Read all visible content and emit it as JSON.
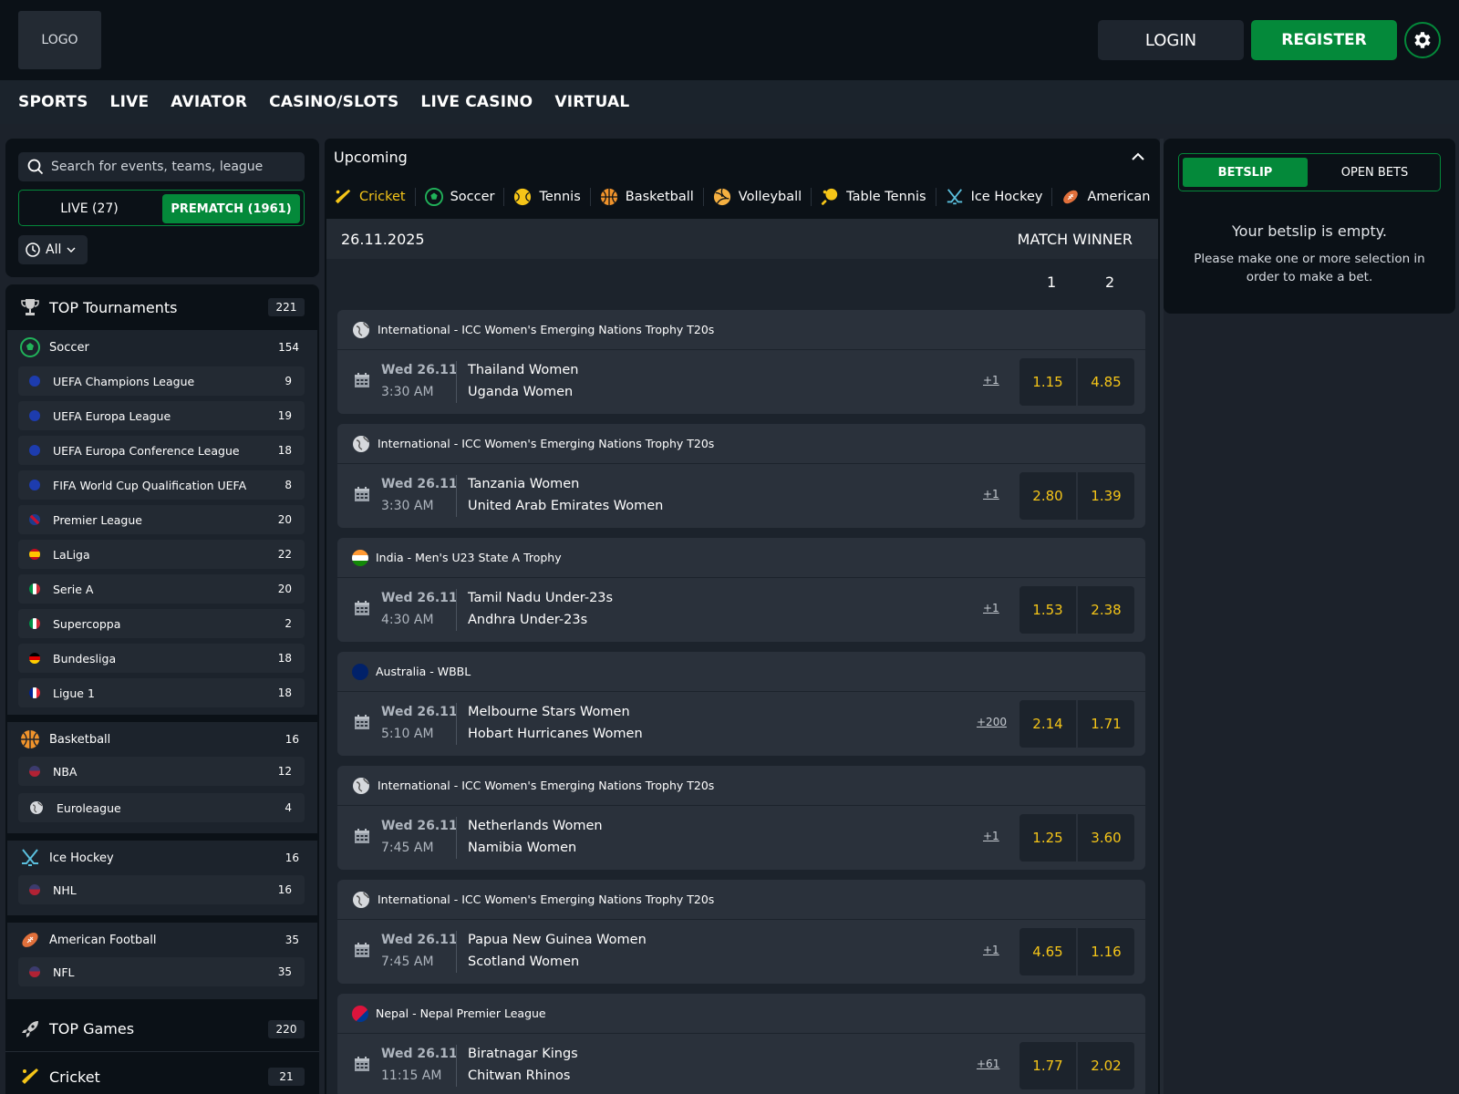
{
  "header": {
    "logo": "LOGO",
    "login": "LOGIN",
    "register": "REGISTER",
    "settings_icon": "gear-icon"
  },
  "nav": [
    "SPORTS",
    "LIVE",
    "AVIATOR",
    "CASINO/SLOTS",
    "LIVE CASINO",
    "VIRTUAL"
  ],
  "filters": {
    "search_placeholder": "Search for events, teams, league",
    "live_label": "LIVE (27)",
    "prematch_label": "PREMATCH (1961)",
    "time_filter": "All"
  },
  "sidebar": {
    "top_tournaments": {
      "title": "TOP Tournaments",
      "count": "221"
    },
    "groups": [
      {
        "sport": "Soccer",
        "count": "154",
        "icon": "soccer-icon",
        "leagues": [
          {
            "name": "UEFA Champions League",
            "count": "9",
            "flag": "eu"
          },
          {
            "name": "UEFA Europa League",
            "count": "19",
            "flag": "eu"
          },
          {
            "name": "UEFA Europa Conference League",
            "count": "18",
            "flag": "eu"
          },
          {
            "name": "FIFA World Cup Qualification UEFA",
            "count": "8",
            "flag": "eu"
          },
          {
            "name": "Premier League",
            "count": "20",
            "flag": "gb"
          },
          {
            "name": "LaLiga",
            "count": "22",
            "flag": "es"
          },
          {
            "name": "Serie A",
            "count": "20",
            "flag": "it"
          },
          {
            "name": "Supercoppa",
            "count": "2",
            "flag": "it"
          },
          {
            "name": "Bundesliga",
            "count": "18",
            "flag": "de"
          },
          {
            "name": "Ligue 1",
            "count": "18",
            "flag": "fr"
          }
        ]
      },
      {
        "sport": "Basketball",
        "count": "16",
        "icon": "basketball-icon",
        "leagues": [
          {
            "name": "NBA",
            "count": "12",
            "flag": "us"
          },
          {
            "name": "Euroleague",
            "count": "4",
            "flag": "world"
          }
        ]
      },
      {
        "sport": "Ice Hockey",
        "count": "16",
        "icon": "ice-hockey-icon",
        "leagues": [
          {
            "name": "NHL",
            "count": "16",
            "flag": "us"
          }
        ]
      },
      {
        "sport": "American Football",
        "count": "35",
        "icon": "american-football-icon",
        "leagues": [
          {
            "name": "NFL",
            "count": "35",
            "flag": "us"
          }
        ]
      }
    ],
    "top_games": {
      "title": "TOP Games",
      "count": "220"
    },
    "cricket": {
      "title": "Cricket",
      "count": "21"
    }
  },
  "center": {
    "section_title": "Upcoming",
    "sport_tabs": [
      {
        "label": "Cricket",
        "icon": "cricket-icon",
        "active": true
      },
      {
        "label": "Soccer",
        "icon": "soccer-icon"
      },
      {
        "label": "Tennis",
        "icon": "tennis-icon"
      },
      {
        "label": "Basketball",
        "icon": "basketball-icon"
      },
      {
        "label": "Volleyball",
        "icon": "volleyball-icon"
      },
      {
        "label": "Table Tennis",
        "icon": "table-tennis-icon"
      },
      {
        "label": "Ice Hockey",
        "icon": "ice-hockey-icon"
      },
      {
        "label": "American",
        "icon": "american-football-icon"
      }
    ],
    "date": "26.11.2025",
    "market": "MATCH WINNER",
    "col1": "1",
    "col2": "2",
    "events": [
      {
        "league": "International - ICC Women's Emerging Nations Trophy T20s",
        "flag": "world",
        "date": "Wed 26.11",
        "time": "3:30 AM",
        "team1": "Thailand Women",
        "team2": "Uganda Women",
        "more": "+1",
        "odd1": "1.15",
        "odd2": "4.85"
      },
      {
        "league": "International - ICC Women's Emerging Nations Trophy T20s",
        "flag": "world",
        "date": "Wed 26.11",
        "time": "3:30 AM",
        "team1": "Tanzania Women",
        "team2": "United Arab Emirates Women",
        "more": "+1",
        "odd1": "2.80",
        "odd2": "1.39"
      },
      {
        "league": "India - Men's U23 State A Trophy",
        "flag": "in",
        "date": "Wed 26.11",
        "time": "4:30 AM",
        "team1": "Tamil Nadu Under-23s",
        "team2": "Andhra Under-23s",
        "more": "+1",
        "odd1": "1.53",
        "odd2": "2.38"
      },
      {
        "league": "Australia - WBBL",
        "flag": "au",
        "date": "Wed 26.11",
        "time": "5:10 AM",
        "team1": "Melbourne Stars Women",
        "team2": "Hobart Hurricanes Women",
        "more": "+200",
        "odd1": "2.14",
        "odd2": "1.71"
      },
      {
        "league": "International - ICC Women's Emerging Nations Trophy T20s",
        "flag": "world",
        "date": "Wed 26.11",
        "time": "7:45 AM",
        "team1": "Netherlands Women",
        "team2": "Namibia Women",
        "more": "+1",
        "odd1": "1.25",
        "odd2": "3.60"
      },
      {
        "league": "International - ICC Women's Emerging Nations Trophy T20s",
        "flag": "world",
        "date": "Wed 26.11",
        "time": "7:45 AM",
        "team1": "Papua New Guinea Women",
        "team2": "Scotland Women",
        "more": "+1",
        "odd1": "4.65",
        "odd2": "1.16"
      },
      {
        "league": "Nepal - Nepal Premier League",
        "flag": "np",
        "date": "Wed 26.11",
        "time": "11:15 AM",
        "team1": "Biratnagar Kings",
        "team2": "Chitwan Rhinos",
        "more": "+61",
        "odd1": "1.77",
        "odd2": "2.02"
      }
    ]
  },
  "betslip": {
    "tab_betslip": "BETSLIP",
    "tab_open": "OPEN BETS",
    "empty_title": "Your betslip is empty.",
    "empty_msg": "Please make one or more selection in order to make a bet."
  },
  "colors": {
    "brand_green": "#04893a",
    "odds_yellow": "#f5c518",
    "background": "#0b1117"
  }
}
